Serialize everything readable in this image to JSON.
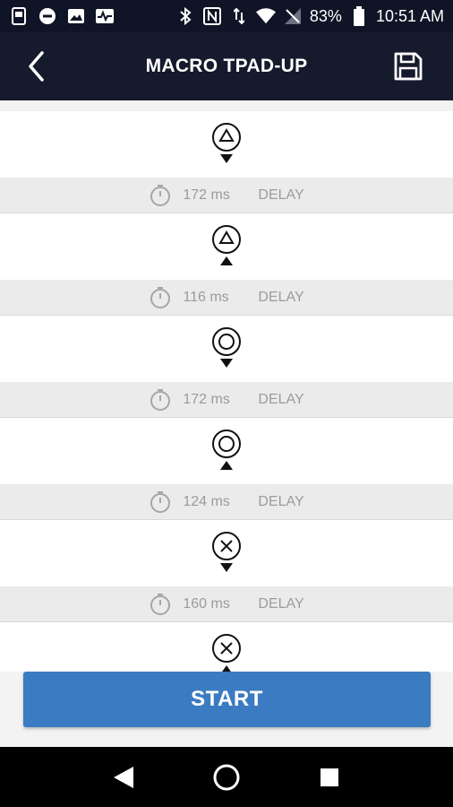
{
  "status_bar": {
    "battery": "83%",
    "time": "10:51 AM"
  },
  "header": {
    "title": "MACRO TPAD-UP"
  },
  "macro_steps": [
    {
      "button": "triangle",
      "direction": "down",
      "delay_ms": "172 ms",
      "delay_label": "DELAY"
    },
    {
      "button": "triangle",
      "direction": "up",
      "delay_ms": "116 ms",
      "delay_label": "DELAY"
    },
    {
      "button": "circle",
      "direction": "down",
      "delay_ms": "172 ms",
      "delay_label": "DELAY"
    },
    {
      "button": "circle",
      "direction": "up",
      "delay_ms": "124 ms",
      "delay_label": "DELAY"
    },
    {
      "button": "cross",
      "direction": "down",
      "delay_ms": "160 ms",
      "delay_label": "DELAY"
    },
    {
      "button": "cross",
      "direction": "up",
      "delay_ms": "",
      "delay_label": ""
    }
  ],
  "start_button": {
    "label": "START"
  },
  "colors": {
    "app_bar": "#151a2c",
    "accent": "#3b7bc2"
  },
  "icons": {
    "back": "chevron-left-icon",
    "save": "floppy-disk-icon",
    "delay": "stopwatch-icon"
  }
}
